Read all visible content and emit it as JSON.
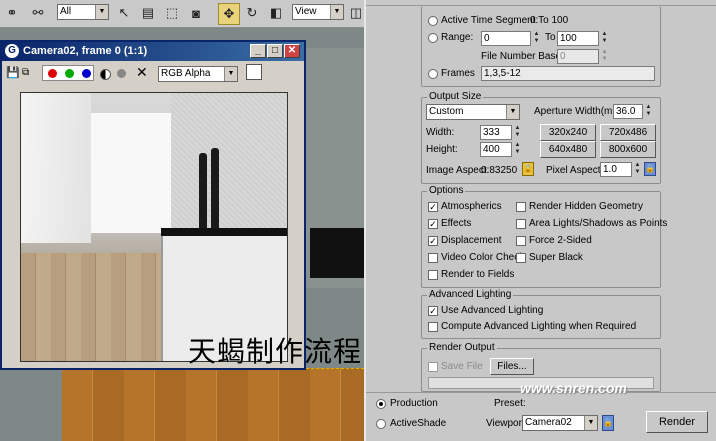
{
  "toolbar": {
    "selection_filter": "All",
    "ref_coord": "View"
  },
  "vfb": {
    "title": "Camera02, frame 0 (1:1)",
    "channel": "RGB Alpha"
  },
  "time_output": {
    "active_time_segment_label": "Active Time Segment:",
    "active_time_segment_value": "0 To 100",
    "range_label": "Range:",
    "range_start": "0",
    "to_label": "To",
    "range_end": "100",
    "file_number_base_label": "File Number Base:",
    "file_number_base": "0",
    "frames_label": "Frames",
    "frames_value": "1,3,5-12"
  },
  "output_size": {
    "title": "Output Size",
    "preset": "Custom",
    "aperture_label": "Aperture Width(mm):",
    "aperture_value": "36.0",
    "width_label": "Width:",
    "width_value": "333",
    "height_label": "Height:",
    "height_value": "400",
    "presets": [
      "320x240",
      "720x486",
      "640x480",
      "800x600"
    ],
    "image_aspect_label": "Image Aspect:",
    "image_aspect_value": "0.83250",
    "pixel_aspect_label": "Pixel Aspect:",
    "pixel_aspect_value": "1.0"
  },
  "options": {
    "title": "Options",
    "items": [
      {
        "label": "Atmospherics",
        "checked": true
      },
      {
        "label": "Render Hidden Geometry",
        "checked": false
      },
      {
        "label": "Effects",
        "checked": true
      },
      {
        "label": "Area Lights/Shadows as Points",
        "checked": false
      },
      {
        "label": "Displacement",
        "checked": true
      },
      {
        "label": "Force 2-Sided",
        "checked": false
      },
      {
        "label": "Video Color Check",
        "checked": false
      },
      {
        "label": "Super Black",
        "checked": false
      },
      {
        "label": "Render to Fields",
        "checked": false
      }
    ]
  },
  "advanced_lighting": {
    "title": "Advanced Lighting",
    "use_label": "Use Advanced Lighting",
    "compute_label": "Compute Advanced Lighting when Required"
  },
  "render_output": {
    "title": "Render Output",
    "save_file_label": "Save File",
    "files_button": "Files..."
  },
  "bottom": {
    "production_label": "Production",
    "activeshade_label": "ActiveShade",
    "preset_label": "Preset:",
    "viewport_label": "Viewport:",
    "viewport_value": "Camera02",
    "render_button": "Render"
  },
  "overlay": {
    "watermark": "天蝎制作流程",
    "site": "www.snren.com"
  }
}
